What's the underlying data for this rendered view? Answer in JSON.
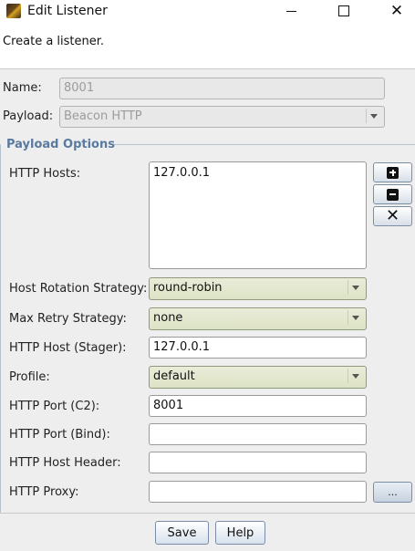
{
  "window": {
    "title": "Edit Listener",
    "description": "Create a listener."
  },
  "form": {
    "name_label": "Name:",
    "name_value": "8001",
    "payload_label": "Payload:",
    "payload_value": "Beacon HTTP"
  },
  "payload_options": {
    "title": "Payload Options",
    "http_hosts_label": "HTTP Hosts:",
    "http_hosts": [
      "127.0.0.1"
    ],
    "host_rotation_label": "Host Rotation Strategy:",
    "host_rotation_value": "round-robin",
    "max_retry_label": "Max Retry Strategy:",
    "max_retry_value": "none",
    "http_host_stager_label": "HTTP Host (Stager):",
    "http_host_stager_value": "127.0.0.1",
    "profile_label": "Profile:",
    "profile_value": "default",
    "http_port_c2_label": "HTTP Port (C2):",
    "http_port_c2_value": "8001",
    "http_port_bind_label": "HTTP Port (Bind):",
    "http_port_bind_value": "",
    "http_host_header_label": "HTTP Host Header:",
    "http_host_header_value": "",
    "http_proxy_label": "HTTP Proxy:",
    "http_proxy_value": "",
    "proxy_button_label": "..."
  },
  "buttons": {
    "save": "Save",
    "help": "Help"
  },
  "icons": {
    "add": "plus-square-icon",
    "remove": "minus-square-icon",
    "clear": "x-icon"
  }
}
